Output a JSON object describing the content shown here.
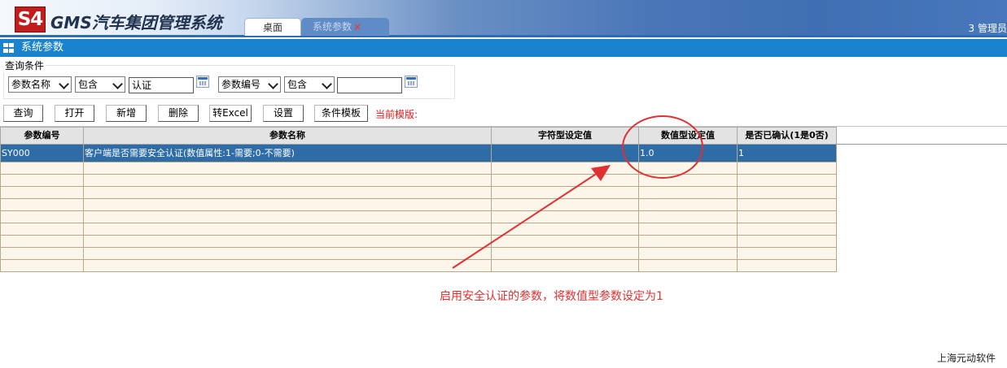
{
  "header": {
    "logo_text": "S4",
    "app_title": "GMS汽车集团管理系统",
    "tabs": [
      {
        "label": "桌面"
      },
      {
        "label": "系统参数",
        "close": "×"
      }
    ],
    "user_label": "3  管理员"
  },
  "page": {
    "title": "系统参数"
  },
  "query": {
    "legend": "查询条件",
    "field1_select": "参数名称",
    "op1_select": "包含",
    "value1": "认证",
    "field2_select": "参数编号",
    "op2_select": "包含",
    "value2": ""
  },
  "toolbar": {
    "query": "查询",
    "open": "打开",
    "add": "新增",
    "delete": "删除",
    "export": "转Excel",
    "settings": "设置",
    "template": "条件模板",
    "current_template": "当前模版:"
  },
  "table": {
    "columns": [
      "参数编号",
      "参数名称",
      "字符型设定值",
      "数值型设定值",
      "是否已确认(1是0否)"
    ],
    "rows": [
      [
        "SY000",
        "客户端是否需要安全认证(数值属性:1-需要;0-不需要)",
        "",
        "1.0",
        "1"
      ]
    ],
    "empty_rows": 9
  },
  "annotation": {
    "text": "启用安全认证的参数，将数值型参数设定为1",
    "color": "#e03131"
  },
  "footer": {
    "company": "上海元动软件"
  },
  "colors": {
    "header_blue": "#2c6bb5",
    "title_bar": "#1a83cf",
    "selected_row": "#2e6ca8",
    "grid_row_bg": "#fcf5ea",
    "logo_red": "#c21d1d"
  }
}
